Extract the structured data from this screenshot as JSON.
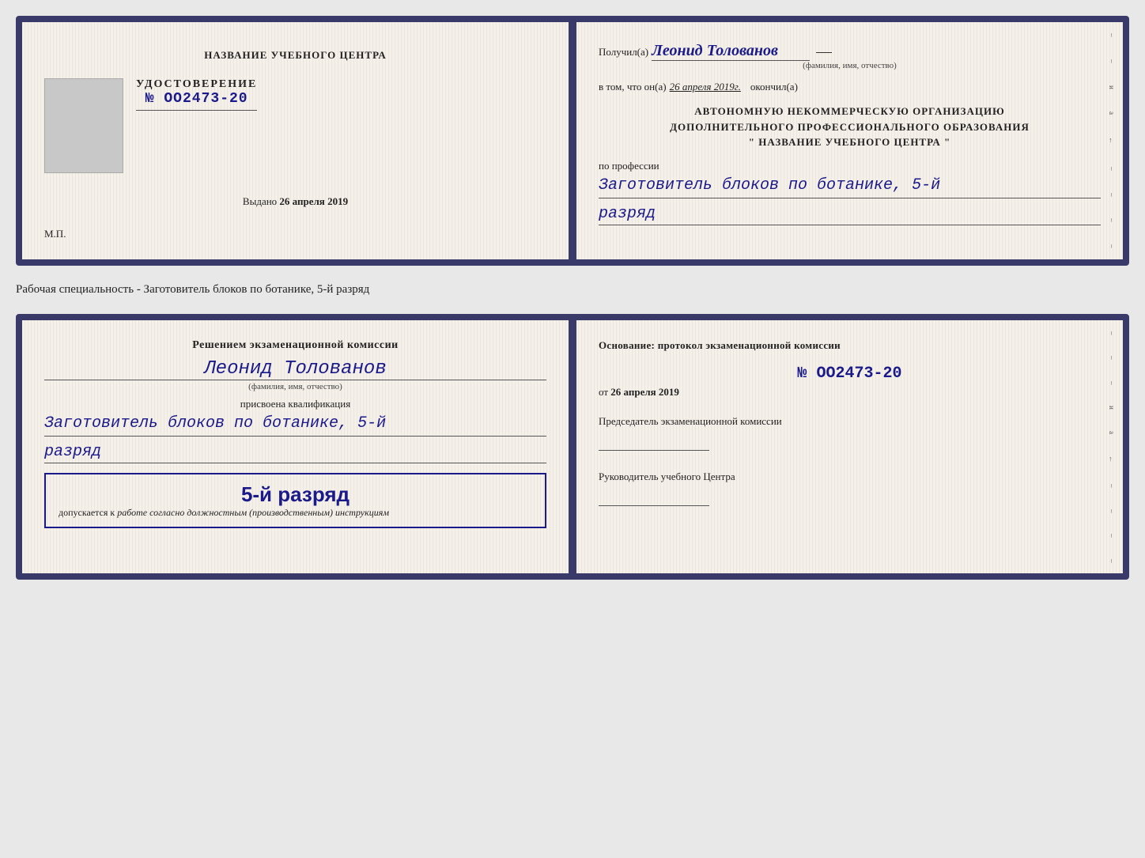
{
  "upper_doc": {
    "left": {
      "training_center": "НАЗВАНИЕ УЧЕБНОГО ЦЕНТРА",
      "cert_label": "УДОСТОВЕРЕНИЕ",
      "cert_number": "№ OO2473-20",
      "issued_label": "Выдано",
      "issued_date": "26 апреля 2019",
      "mp_label": "М.П."
    },
    "right": {
      "received_label": "Получил(а)",
      "recipient_name": "Леонид Толованов",
      "name_hint": "(фамилия, имя, отчество)",
      "certified_text": "в том, что он(а)",
      "certified_date": "26 апреля 2019г.",
      "completed_label": "окончил(а)",
      "org_line1": "АВТОНОМНУЮ НЕКОММЕРЧЕСКУЮ ОРГАНИЗАЦИЮ",
      "org_line2": "ДОПОЛНИТЕЛЬНОГО ПРОФЕССИОНАЛЬНОГО ОБРАЗОВАНИЯ",
      "org_line3": "\"   НАЗВАНИЕ УЧЕБНОГО ЦЕНТРА   \"",
      "profession_label": "по профессии",
      "profession_value": "Заготовитель блоков по ботанике, 5-й",
      "rank_value": "разряд"
    }
  },
  "specialty_label": "Рабочая специальность - Заготовитель блоков по ботанике, 5-й разряд",
  "lower_doc": {
    "left": {
      "decision_text": "Решением экзаменационной комиссии",
      "person_name": "Леонид Толованов",
      "name_hint": "(фамилия, имя, отчество)",
      "assigned_text": "присвоена квалификация",
      "qualification_value": "Заготовитель блоков по ботанике, 5-й",
      "rank_value": "разряд",
      "rank_badge": "5-й разряд",
      "allowed_text": "допускается к",
      "allowed_italic": "работе согласно должностным (производственным) инструкциям"
    },
    "right": {
      "basis_text": "Основание: протокол экзаменационной комиссии",
      "protocol_number": "№  OO2473-20",
      "from_label": "от",
      "from_date": "26 апреля 2019",
      "chairman_label": "Председатель экзаменационной комиссии",
      "director_label": "Руководитель учебного Центра"
    }
  }
}
